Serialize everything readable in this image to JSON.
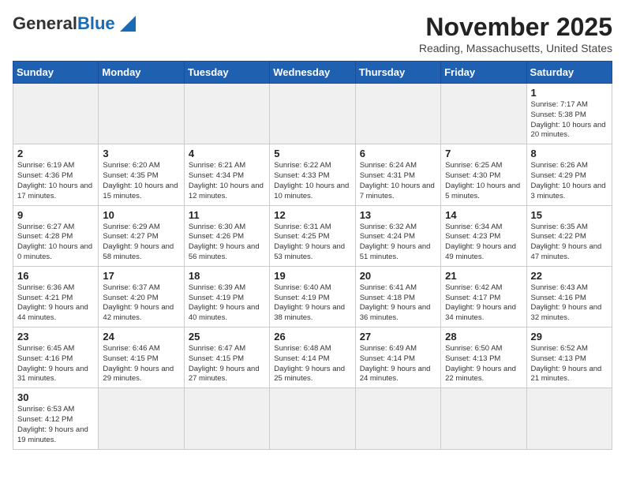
{
  "header": {
    "logo_general": "General",
    "logo_blue": "Blue",
    "month_title": "November 2025",
    "location": "Reading, Massachusetts, United States"
  },
  "weekdays": [
    "Sunday",
    "Monday",
    "Tuesday",
    "Wednesday",
    "Thursday",
    "Friday",
    "Saturday"
  ],
  "weeks": [
    [
      {
        "day": "",
        "info": ""
      },
      {
        "day": "",
        "info": ""
      },
      {
        "day": "",
        "info": ""
      },
      {
        "day": "",
        "info": ""
      },
      {
        "day": "",
        "info": ""
      },
      {
        "day": "",
        "info": ""
      },
      {
        "day": "1",
        "info": "Sunrise: 7:17 AM\nSunset: 5:38 PM\nDaylight: 10 hours\nand 20 minutes."
      }
    ],
    [
      {
        "day": "2",
        "info": "Sunrise: 6:19 AM\nSunset: 4:36 PM\nDaylight: 10 hours\nand 17 minutes."
      },
      {
        "day": "3",
        "info": "Sunrise: 6:20 AM\nSunset: 4:35 PM\nDaylight: 10 hours\nand 15 minutes."
      },
      {
        "day": "4",
        "info": "Sunrise: 6:21 AM\nSunset: 4:34 PM\nDaylight: 10 hours\nand 12 minutes."
      },
      {
        "day": "5",
        "info": "Sunrise: 6:22 AM\nSunset: 4:33 PM\nDaylight: 10 hours\nand 10 minutes."
      },
      {
        "day": "6",
        "info": "Sunrise: 6:24 AM\nSunset: 4:31 PM\nDaylight: 10 hours\nand 7 minutes."
      },
      {
        "day": "7",
        "info": "Sunrise: 6:25 AM\nSunset: 4:30 PM\nDaylight: 10 hours\nand 5 minutes."
      },
      {
        "day": "8",
        "info": "Sunrise: 6:26 AM\nSunset: 4:29 PM\nDaylight: 10 hours\nand 3 minutes."
      }
    ],
    [
      {
        "day": "9",
        "info": "Sunrise: 6:27 AM\nSunset: 4:28 PM\nDaylight: 10 hours\nand 0 minutes."
      },
      {
        "day": "10",
        "info": "Sunrise: 6:29 AM\nSunset: 4:27 PM\nDaylight: 9 hours\nand 58 minutes."
      },
      {
        "day": "11",
        "info": "Sunrise: 6:30 AM\nSunset: 4:26 PM\nDaylight: 9 hours\nand 56 minutes."
      },
      {
        "day": "12",
        "info": "Sunrise: 6:31 AM\nSunset: 4:25 PM\nDaylight: 9 hours\nand 53 minutes."
      },
      {
        "day": "13",
        "info": "Sunrise: 6:32 AM\nSunset: 4:24 PM\nDaylight: 9 hours\nand 51 minutes."
      },
      {
        "day": "14",
        "info": "Sunrise: 6:34 AM\nSunset: 4:23 PM\nDaylight: 9 hours\nand 49 minutes."
      },
      {
        "day": "15",
        "info": "Sunrise: 6:35 AM\nSunset: 4:22 PM\nDaylight: 9 hours\nand 47 minutes."
      }
    ],
    [
      {
        "day": "16",
        "info": "Sunrise: 6:36 AM\nSunset: 4:21 PM\nDaylight: 9 hours\nand 44 minutes."
      },
      {
        "day": "17",
        "info": "Sunrise: 6:37 AM\nSunset: 4:20 PM\nDaylight: 9 hours\nand 42 minutes."
      },
      {
        "day": "18",
        "info": "Sunrise: 6:39 AM\nSunset: 4:19 PM\nDaylight: 9 hours\nand 40 minutes."
      },
      {
        "day": "19",
        "info": "Sunrise: 6:40 AM\nSunset: 4:19 PM\nDaylight: 9 hours\nand 38 minutes."
      },
      {
        "day": "20",
        "info": "Sunrise: 6:41 AM\nSunset: 4:18 PM\nDaylight: 9 hours\nand 36 minutes."
      },
      {
        "day": "21",
        "info": "Sunrise: 6:42 AM\nSunset: 4:17 PM\nDaylight: 9 hours\nand 34 minutes."
      },
      {
        "day": "22",
        "info": "Sunrise: 6:43 AM\nSunset: 4:16 PM\nDaylight: 9 hours\nand 32 minutes."
      }
    ],
    [
      {
        "day": "23",
        "info": "Sunrise: 6:45 AM\nSunset: 4:16 PM\nDaylight: 9 hours\nand 31 minutes."
      },
      {
        "day": "24",
        "info": "Sunrise: 6:46 AM\nSunset: 4:15 PM\nDaylight: 9 hours\nand 29 minutes."
      },
      {
        "day": "25",
        "info": "Sunrise: 6:47 AM\nSunset: 4:15 PM\nDaylight: 9 hours\nand 27 minutes."
      },
      {
        "day": "26",
        "info": "Sunrise: 6:48 AM\nSunset: 4:14 PM\nDaylight: 9 hours\nand 25 minutes."
      },
      {
        "day": "27",
        "info": "Sunrise: 6:49 AM\nSunset: 4:14 PM\nDaylight: 9 hours\nand 24 minutes."
      },
      {
        "day": "28",
        "info": "Sunrise: 6:50 AM\nSunset: 4:13 PM\nDaylight: 9 hours\nand 22 minutes."
      },
      {
        "day": "29",
        "info": "Sunrise: 6:52 AM\nSunset: 4:13 PM\nDaylight: 9 hours\nand 21 minutes."
      }
    ],
    [
      {
        "day": "30",
        "info": "Sunrise: 6:53 AM\nSunset: 4:12 PM\nDaylight: 9 hours\nand 19 minutes."
      },
      {
        "day": "",
        "info": ""
      },
      {
        "day": "",
        "info": ""
      },
      {
        "day": "",
        "info": ""
      },
      {
        "day": "",
        "info": ""
      },
      {
        "day": "",
        "info": ""
      },
      {
        "day": "",
        "info": ""
      }
    ]
  ]
}
